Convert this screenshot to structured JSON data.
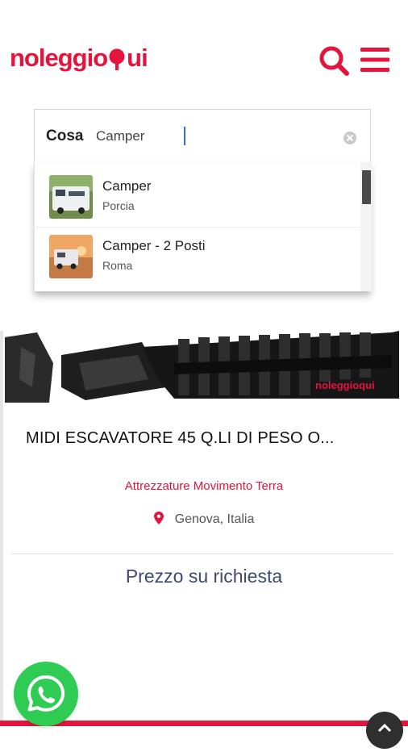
{
  "header": {
    "logo_text_left": "noleggio",
    "logo_text_right": "ui",
    "brand_color": "#e4143c",
    "icons": [
      "search-icon",
      "menu-icon"
    ]
  },
  "search": {
    "label": "Cosa",
    "value": "Camper",
    "placeholder": ""
  },
  "suggestions": [
    {
      "title": "Camper",
      "location": "Porcia"
    },
    {
      "title": "Camper - 2 Posti",
      "location": "Roma"
    }
  ],
  "listing": {
    "title": "MIDI ESCAVATORE 45 Q.LI DI PESO O...",
    "category": "Attrezzature Movimento Terra",
    "location": "Genova, Italia",
    "price": "Prezzo su richiesta",
    "image_watermark": "noleggioqui"
  },
  "floating": {
    "whatsapp_icon": "whatsapp-icon",
    "scroll_top_icon": "arrow-up-icon"
  }
}
